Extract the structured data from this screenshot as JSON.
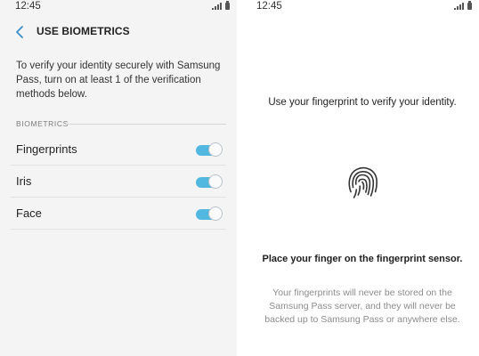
{
  "left_screen": {
    "status": {
      "time": "12:45"
    },
    "header": {
      "title": "USE BIOMETRICS"
    },
    "intro": "To verify your identity securely with Samsung Pass, turn on at least 1 of the verification methods below.",
    "section_title": "BIOMETRICS",
    "items": [
      {
        "label": "Fingerprints",
        "enabled": true
      },
      {
        "label": "Iris",
        "enabled": true
      },
      {
        "label": "Face",
        "enabled": true
      }
    ]
  },
  "right_screen": {
    "status": {
      "time": "12:45"
    },
    "heading": "Use your fingerprint to verify your identity.",
    "instruction": "Place your finger on the fingerprint sensor.",
    "disclaimer": "Your fingerprints will never be stored on the Samsung Pass server, and they will never be backed up to Samsung Pass or anywhere else."
  },
  "icons": {
    "back": "chevron-left-icon",
    "fingerprint": "fingerprint-icon",
    "signal": "signal-icon",
    "battery": "battery-icon"
  },
  "colors": {
    "toggle_on": "#53b8e0",
    "back_arrow": "#3a8fc6",
    "left_background": "#f4f4f4"
  }
}
